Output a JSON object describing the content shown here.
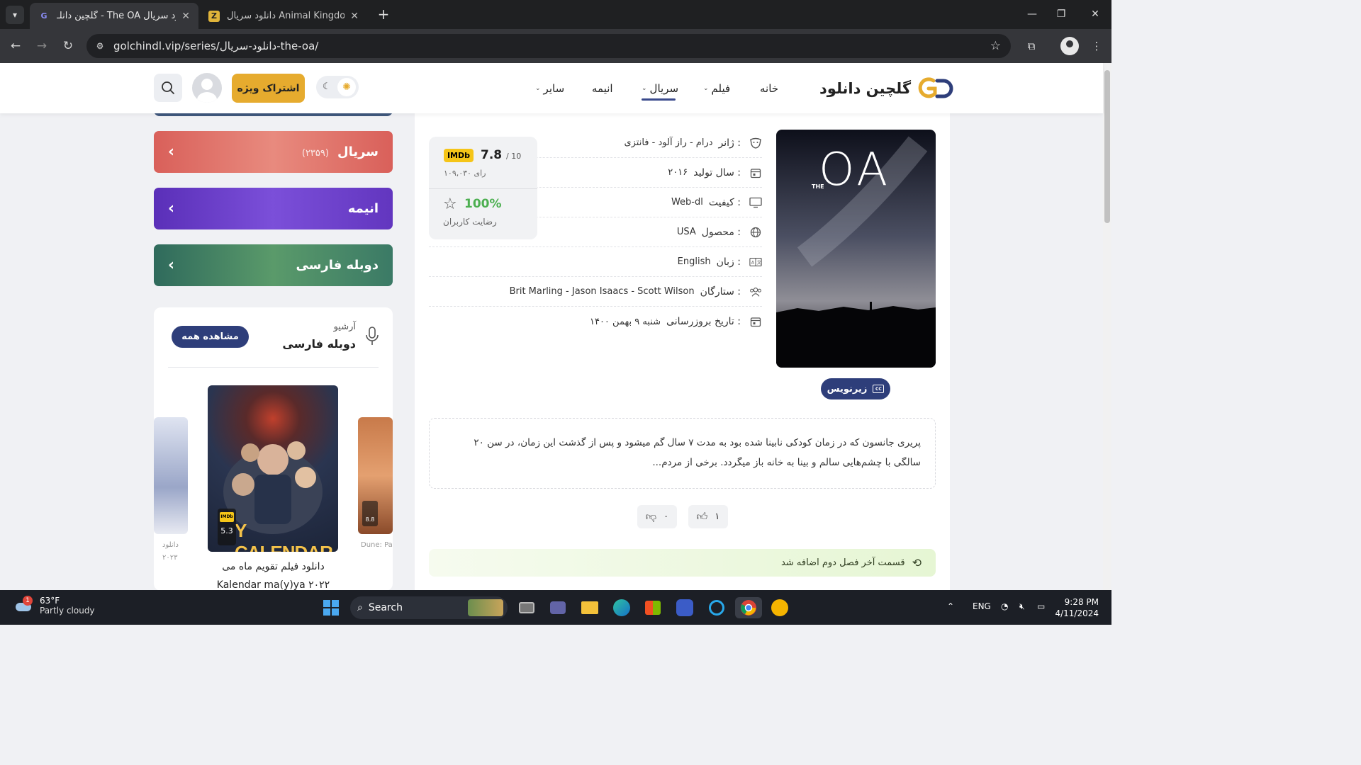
{
  "browser": {
    "tabs": [
      {
        "title": "گلچین دانلـ - The OA دانلود سریال",
        "active": true
      },
      {
        "title": "دانلود سریال Animal Kingdom با",
        "active": false
      }
    ],
    "url": "golchindl.vip/series/دانلود-سریال-the-oa/"
  },
  "site": {
    "logo_text": "گلچین دانلود",
    "nav": {
      "home": "خانه",
      "film": "فیلم",
      "series": "سریال",
      "anime": "انیمه",
      "other": "سایر"
    },
    "vip_button": "اشتراک ویژه"
  },
  "sidebar": {
    "categories": [
      {
        "label": "سریال",
        "count": "(۲۳۵۹)"
      },
      {
        "label": "انیمه",
        "count": ""
      },
      {
        "label": "دوبله فارسی",
        "count": ""
      }
    ],
    "archive": {
      "kicker": "آرشیو",
      "title": "دوبله فارسی",
      "see_all": "مشاهده همه",
      "featured_rating": "5.3",
      "featured_rating_label": "IMDb",
      "poster_text": "Y CALENDAR",
      "side_rating": "8.8",
      "left_caption": "دانلود",
      "left_caption_2": "۲۰۲۳",
      "right_caption": "Dune: Pa",
      "caption_line1": "دانلود فیلم تقویم ماه می",
      "caption_line2": "Kalendar ma(y)ya ۲۰۲۲"
    }
  },
  "movie": {
    "poster_title": "OA",
    "poster_the": "THE",
    "subtitle_badge": "زیرنویس",
    "info": [
      {
        "key": "ژانر :",
        "value": "درام - راز آلود - فانتزی",
        "icon": "mask-icon"
      },
      {
        "key": "سال تولید :",
        "value": "۲۰۱۶",
        "icon": "calendar-icon"
      },
      {
        "key": "کیفیت :",
        "value": "Web-dl",
        "icon": "monitor-icon"
      },
      {
        "key": "محصول :",
        "value": "USA",
        "icon": "globe-icon"
      },
      {
        "key": "زبان :",
        "value": "English",
        "icon": "language-icon"
      },
      {
        "key": "ستارگان :",
        "value": "Brit Marling - Jason Isaacs - Scott Wilson",
        "icon": "people-icon"
      },
      {
        "key": "تاریخ بروزرسانی :",
        "value": "شنبه ۹ بهمن ۱۴۰۰",
        "icon": "calendar-update-icon"
      }
    ],
    "imdb": {
      "label": "IMDb",
      "score": "7.8",
      "out_of": "/ 10",
      "votes": "۱۰۹,۰۳۰ رای"
    },
    "user_satisfaction": {
      "percent": "100%",
      "label": "رضایت کاربران"
    },
    "synopsis": "پریری جانسون که در زمان کودکی نابینا شده بود به مدت ۷ سال گم میشود و پس از گذشت این زمان، در سن ۲۰ سالگی با چشم‌هایی سالم و بینا به خانه باز میگردد. برخی از مردم...",
    "likes": "۱",
    "dislikes": "۰",
    "notice": "قسمت آخر فصل دوم اضافه شد"
  },
  "taskbar": {
    "weather_temp": "63°F",
    "weather_desc": "Partly cloudy",
    "weather_badge": "1",
    "search": "Search",
    "lang": "ENG",
    "time": "9:28 PM",
    "date": "4/11/2024"
  },
  "colors": {
    "accent_navy": "#2e3e7a",
    "vip_gold": "#e6ab2e",
    "imdb_yellow": "#f5c518",
    "satisfaction_green": "#4caf50"
  }
}
